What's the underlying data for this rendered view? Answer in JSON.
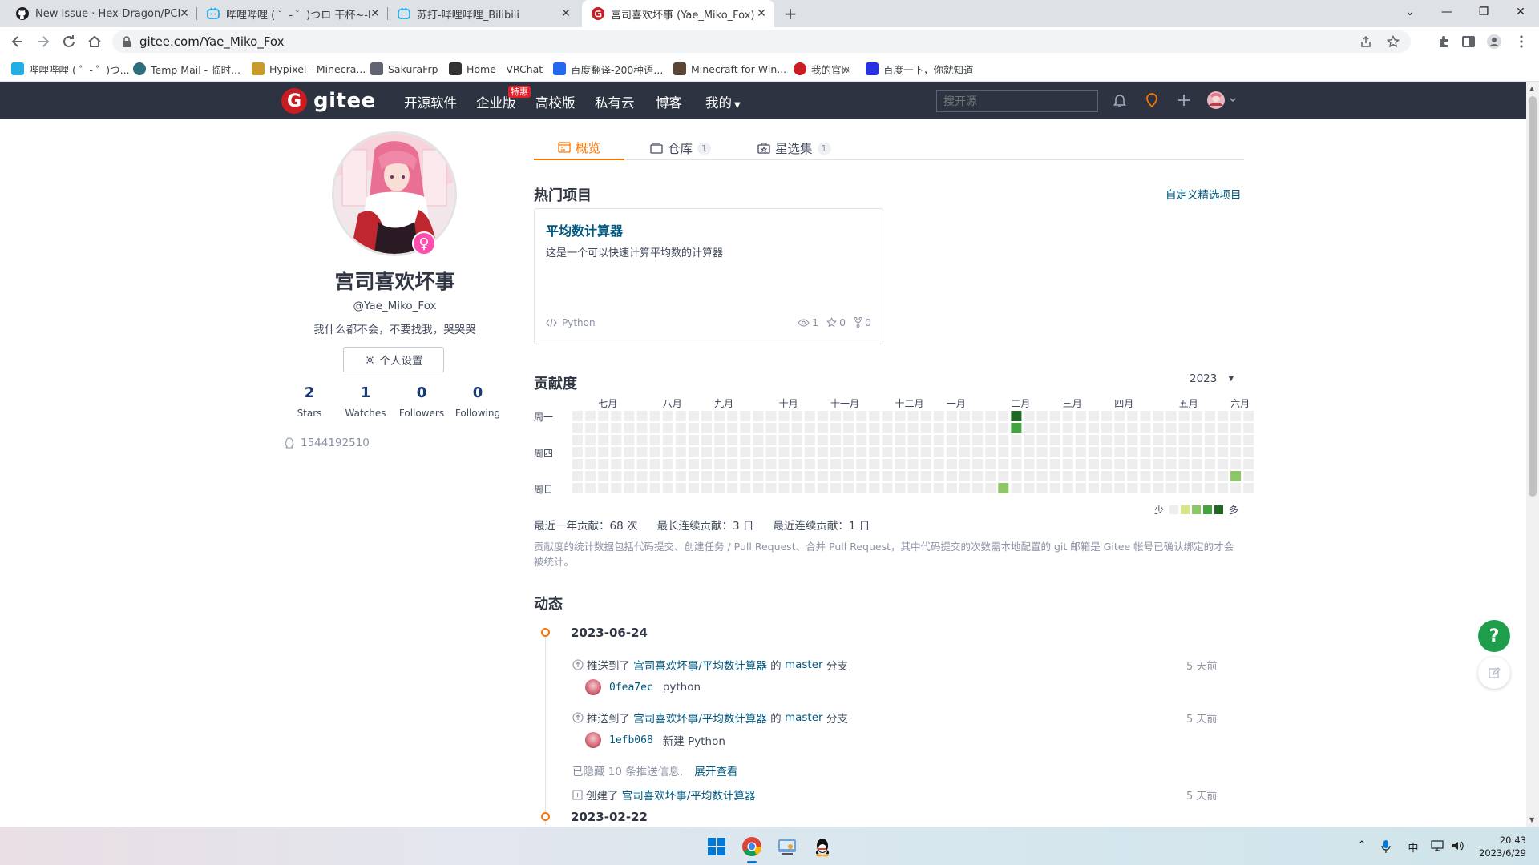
{
  "browser": {
    "tabs": [
      {
        "title": "New Issue · Hex-Dragon/PCL2",
        "icon": "github-icon",
        "active": false
      },
      {
        "title": "哔哩哔哩 ( ゜- ゜)つロ 干杯~-bilil",
        "icon": "bilibili-icon",
        "active": false
      },
      {
        "title": "苏打-哔哩哔哩_Bilibili",
        "icon": "bilibili-icon",
        "active": false
      },
      {
        "title": "宫司喜欢坏事 (Yae_Miko_Fox) · ",
        "icon": "gitee-favicon-icon",
        "active": true
      }
    ],
    "url": "gitee.com/Yae_Miko_Fox",
    "bookmarks": [
      {
        "label": "哔哩哔哩 ( ゜- ゜)つ...",
        "color": "#23ade5"
      },
      {
        "label": "Temp Mail - 临时...",
        "color": "#2c6e7a"
      },
      {
        "label": "Hypixel - Minecra...",
        "color": "#c79a2a"
      },
      {
        "label": "SakuraFrp",
        "color": "#5e6470"
      },
      {
        "label": "Home - VRChat",
        "color": "#333333"
      },
      {
        "label": "百度翻译-200种语...",
        "color": "#2468f2"
      },
      {
        "label": "Minecraft for Win...",
        "color": "#5b4636"
      },
      {
        "label": "我的官网",
        "color": "#c71d23"
      },
      {
        "label": "百度一下，你就知道",
        "color": "#2932e1"
      }
    ]
  },
  "header": {
    "logo": "gitee",
    "nav": [
      "开源软件",
      "企业版",
      "高校版",
      "私有云",
      "博客",
      "我的"
    ],
    "badge": "特惠",
    "search_placeholder": "搜开源"
  },
  "profile": {
    "name": "宫司喜欢坏事",
    "handle": "@Yae_Miko_Fox",
    "bio": "我什么都不会，不要找我，哭哭哭",
    "settings_label": "个人设置",
    "stats": [
      {
        "num": "2",
        "label": "Stars"
      },
      {
        "num": "1",
        "label": "Watches"
      },
      {
        "num": "0",
        "label": "Followers"
      },
      {
        "num": "0",
        "label": "Following"
      }
    ],
    "qq": "1544192510"
  },
  "tabs": [
    {
      "label": "概览",
      "count": ""
    },
    {
      "label": "仓库",
      "count": "1"
    },
    {
      "label": "星选集",
      "count": "1"
    }
  ],
  "popular": {
    "title": "热门项目",
    "customize": "自定义精选项目",
    "project": {
      "name": "平均数计算器",
      "desc": "这是一个可以快速计算平均数的计算器",
      "lang": "Python",
      "watches": "1",
      "stars": "0",
      "forks": "0"
    }
  },
  "contrib": {
    "title": "贡献度",
    "year": "2023",
    "months": [
      "七月",
      "八月",
      "九月",
      "十月",
      "十一月",
      "十二月",
      "一月",
      "二月",
      "三月",
      "四月",
      "五月",
      "六月"
    ],
    "days": [
      "周一",
      "周四",
      "周日"
    ],
    "cells": [
      {
        "week": 34,
        "day": 0,
        "level": 4
      },
      {
        "week": 34,
        "day": 1,
        "level": 3
      },
      {
        "week": 33,
        "day": 6,
        "level": 2
      },
      {
        "week": 51,
        "day": 5,
        "level": 2
      }
    ],
    "legend_less": "少",
    "legend_more": "多",
    "legend_colors": [
      "#eeeeee",
      "#d6e685",
      "#8cc665",
      "#44a340",
      "#1e6823"
    ],
    "summary": [
      "最近一年贡献：68 次",
      "最长连续贡献：3 日",
      "最近连续贡献：1 日"
    ],
    "note": "贡献度的统计数据包括代码提交、创建任务 / Pull Request、合并 Pull Request，其中代码提交的次数需本地配置的 git 邮箱是 Gitee 帐号已确认绑定的才会被统计。"
  },
  "activity": {
    "title": "动态",
    "groups": [
      {
        "date": "2023-06-24",
        "events": [
          {
            "prefix": "推送到了",
            "repo": "宫司喜欢坏事/平均数计算器",
            "mid": "的",
            "branch": "master",
            "suffix": "分支",
            "time": "5 天前",
            "sha": "0fea7ec",
            "msg": "python"
          },
          {
            "prefix": "推送到了",
            "repo": "宫司喜欢坏事/平均数计算器",
            "mid": "的",
            "branch": "master",
            "suffix": "分支",
            "time": "5 天前",
            "sha": "1efb068",
            "msg": "新建 Python"
          }
        ],
        "hidden_note": "已隐藏 10 条推送信息,",
        "expand": "展开查看",
        "create": {
          "prefix": "创建了",
          "repo": "宫司喜欢坏事/平均数计算器",
          "time": "5 天前"
        }
      },
      {
        "date": "2023-02-22"
      }
    ]
  },
  "floating": {
    "help": "?"
  },
  "taskbar": {
    "time": "20:43",
    "date": "2023/6/29",
    "ime": "中"
  }
}
